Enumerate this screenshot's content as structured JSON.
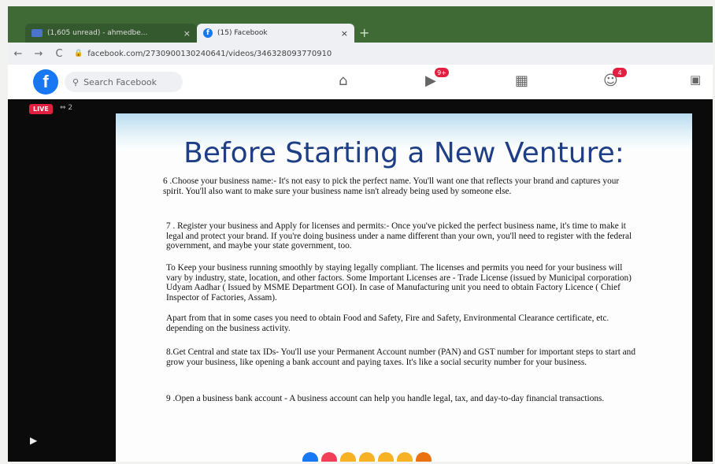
{
  "browser": {
    "tabs": [
      {
        "label": "(1,605 unread) - ahmedbe...",
        "close": "×"
      },
      {
        "label": "(15) Facebook",
        "close": "×"
      }
    ],
    "new_tab": "+",
    "nav": {
      "back": "←",
      "forward": "→",
      "reload": "C"
    },
    "url": "facebook.com/2730900130240641/videos/346328093770910"
  },
  "fb": {
    "logo": "f",
    "search_placeholder": "Search Facebook",
    "badges": {
      "watch": "9+",
      "groups": "4"
    }
  },
  "live": {
    "label": "LIVE",
    "viewers": "⇔ 2"
  },
  "slide": {
    "title": "Before Starting a New Venture:",
    "paragraphs": [
      "6 .Choose your business name:- It's not easy to pick the perfect name. You'll want one that reflects your brand and captures your spirit. You'll also want to make sure your business name isn't already being used by someone else.",
      "7 . Register your business and Apply for licenses and permits:- Once you've picked the perfect business name, it's time to make it legal and protect your brand. If you're doing business under a name different than your own, you'll need to register with the federal government, and maybe your state government, too.",
      "To Keep your business running smoothly by staying legally compliant. The licenses and permits you need for your business will vary by industry, state, location, and other factors. Some Important Licenses are - Trade License (issued by Municipal corporation) Udyam Aadhar ( Issued by MSME Department GOI). In case of Manufacturing unit you need to obtain Factory Licence ( Chief Inspector of Factories, Assam).",
      "Apart from that in some cases you need to obtain Food and Safety, Fire and Safety, Environmental Clearance certificate, etc. depending on the business activity.",
      "8.Get Central and state tax IDs- You'll use your Permanent Account number (PAN) and GST number for important steps to start and grow your business, like opening a bank account and paying taxes. It's like a social security number for your business.",
      "9 .Open a business bank account - A business account can help you handle legal, tax, and day-to-day financial transactions."
    ]
  },
  "colors": {
    "fb_blue": "#1877f2",
    "title_blue": "#1e3f86",
    "live_red": "#e41e3f",
    "tab_green": "#3f6a36"
  }
}
